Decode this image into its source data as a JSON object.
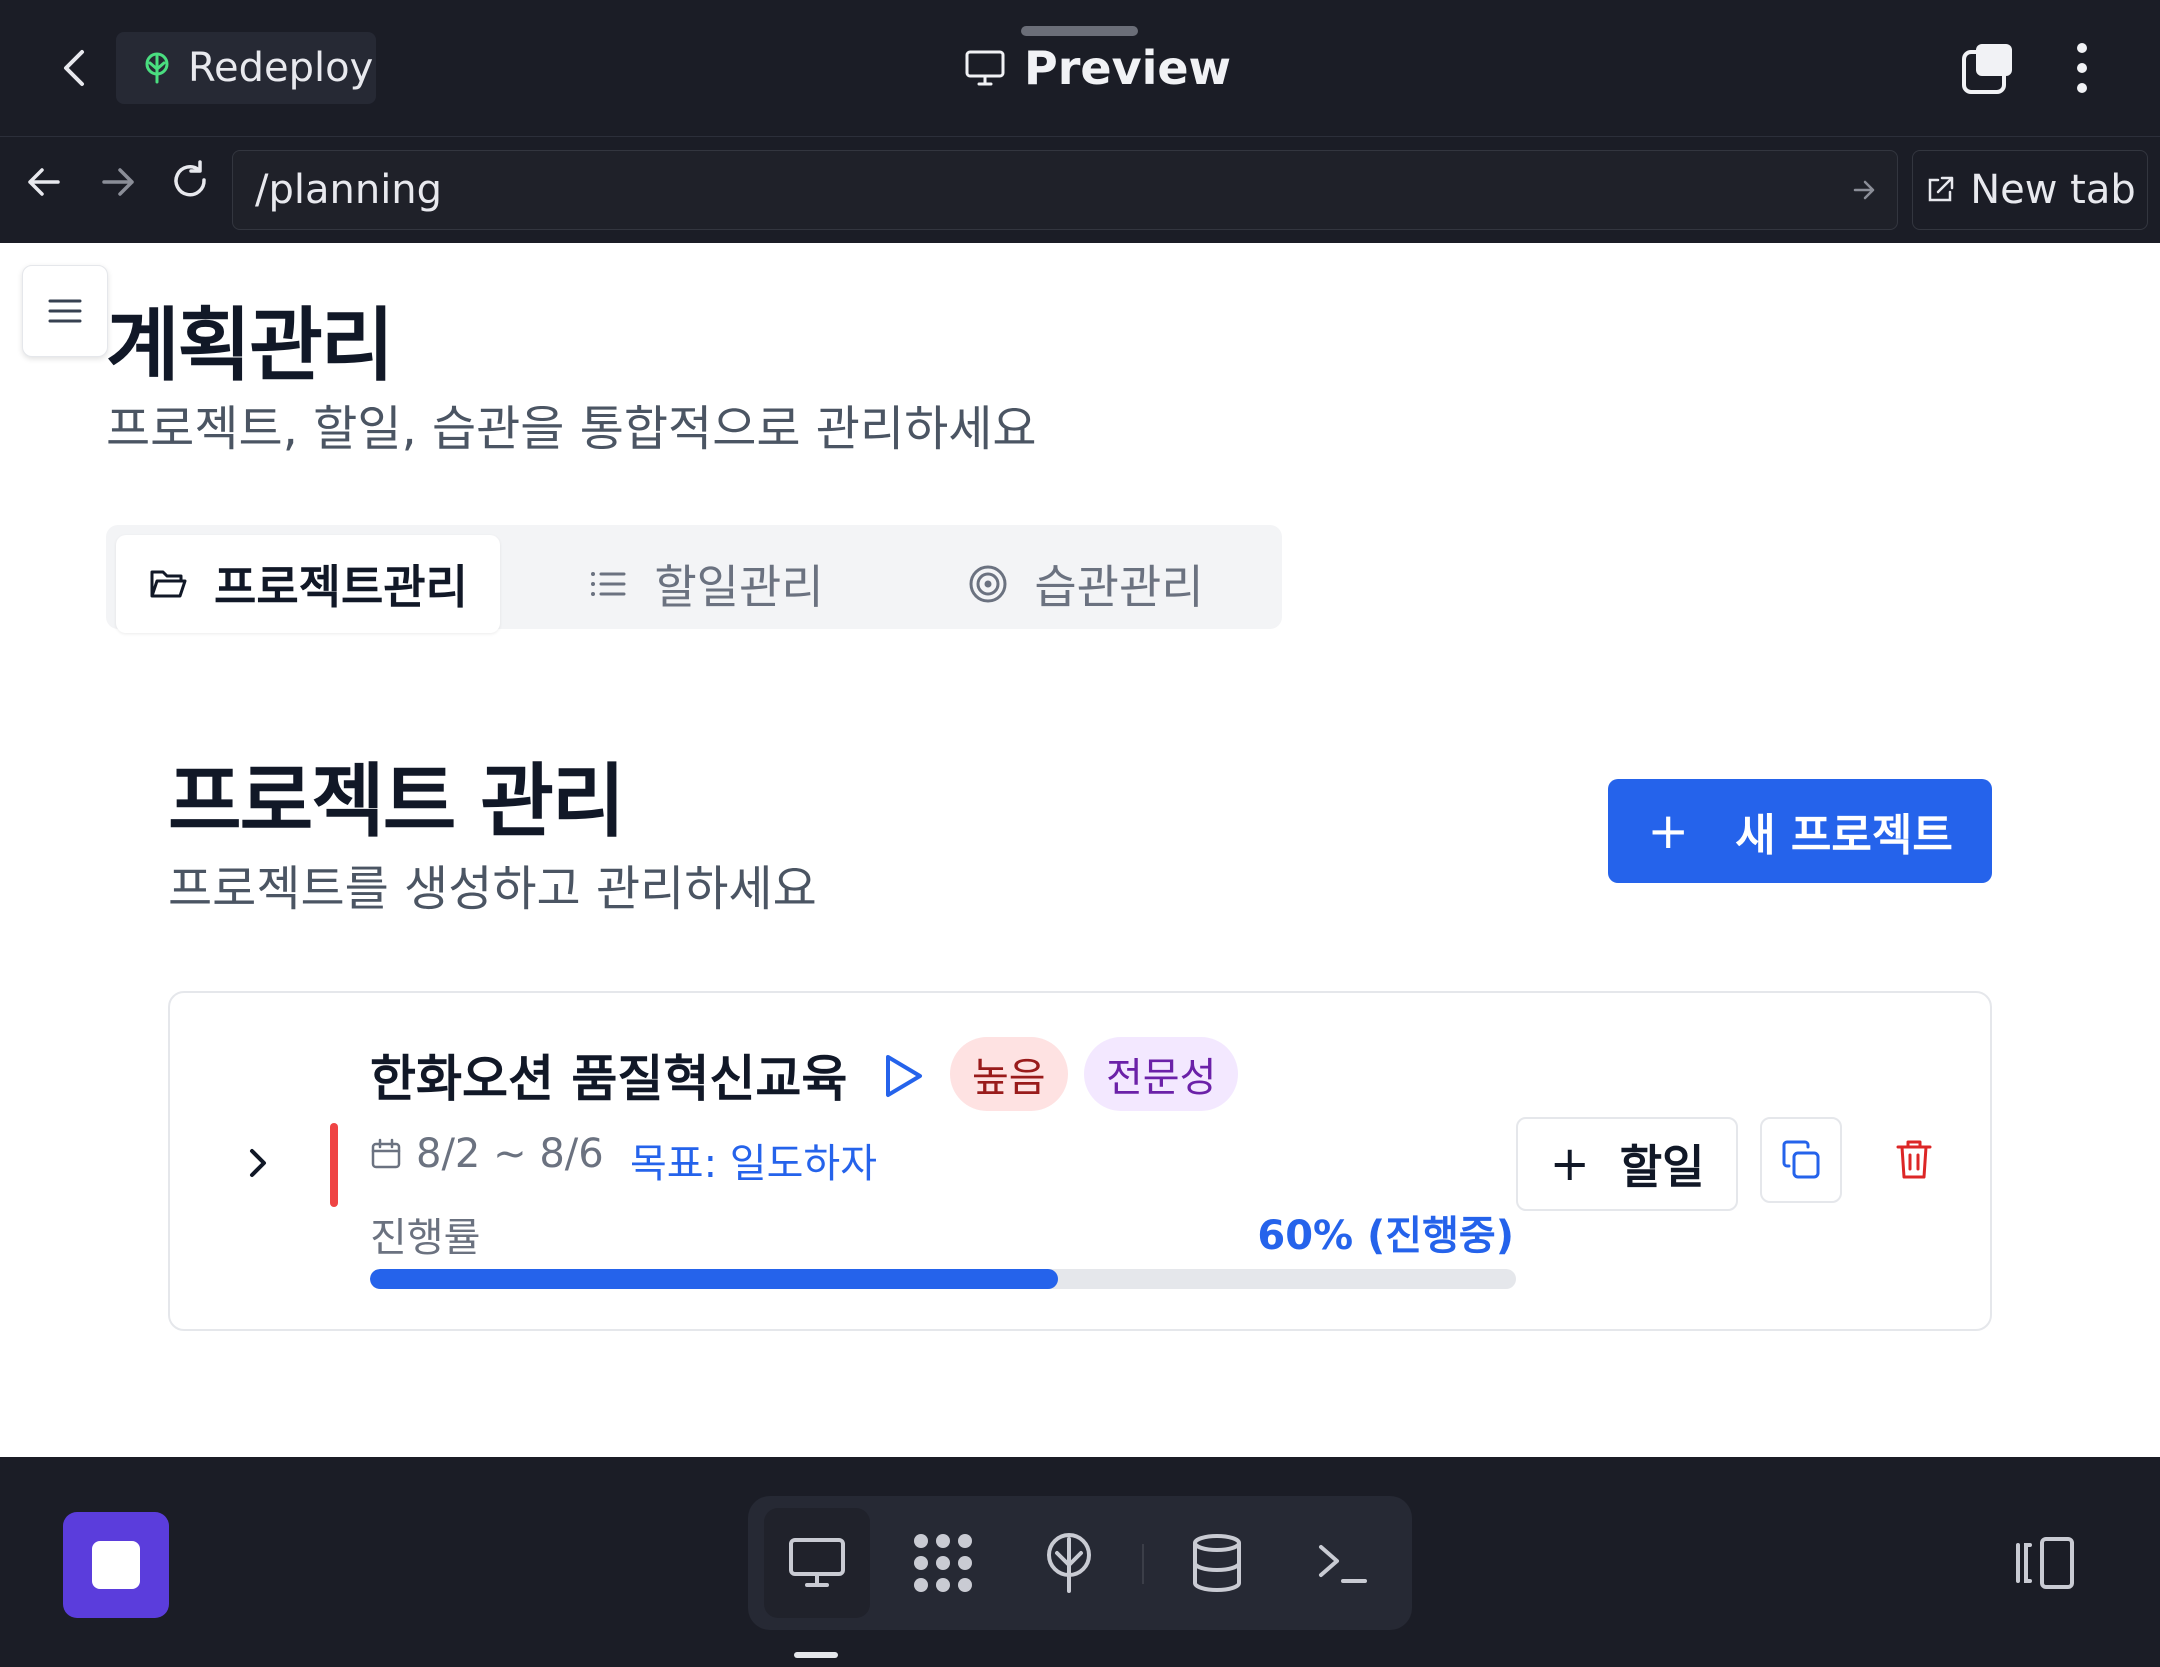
{
  "topbar": {
    "redeploy_label": "Redeploy",
    "title": "Preview"
  },
  "urlbar": {
    "url": "/planning",
    "new_tab_label": "New tab"
  },
  "page": {
    "title": "계획관리",
    "subtitle": "프로젝트, 할일, 습관을 통합적으로 관리하세요"
  },
  "tabs": [
    {
      "label": "프로젝트관리",
      "icon": "folder-icon",
      "active": true
    },
    {
      "label": "할일관리",
      "icon": "list-icon",
      "active": false
    },
    {
      "label": "습관관리",
      "icon": "target-icon",
      "active": false
    }
  ],
  "section": {
    "title": "프로젝트 관리",
    "subtitle": "프로젝트를 생성하고 관리하세요",
    "new_button_label": "새 프로젝트",
    "new_button_plus": "+"
  },
  "project": {
    "name": "한화오션 품질혁신교육",
    "priority_badge": "높음",
    "category_badge": "전문성",
    "dates": "8/2 ~ 8/6",
    "goal": "목표: 일도하자",
    "progress_label": "진행률",
    "progress_text": "60% (진행중)",
    "progress_percent": 60,
    "add_todo_label": "할일",
    "add_todo_plus": "+"
  },
  "colors": {
    "accent": "#2563eb",
    "priority_high": "#ef4444",
    "stop_button": "#5b3ddc",
    "chrome_bg": "#1b1d26"
  },
  "icons": {
    "back": "chevron-left-icon",
    "redeploy": "tree-icon",
    "preview": "monitor-icon",
    "dock": [
      "monitor-icon",
      "grid-dots-icon",
      "tree-icon",
      "database-icon",
      "terminal-icon"
    ]
  }
}
